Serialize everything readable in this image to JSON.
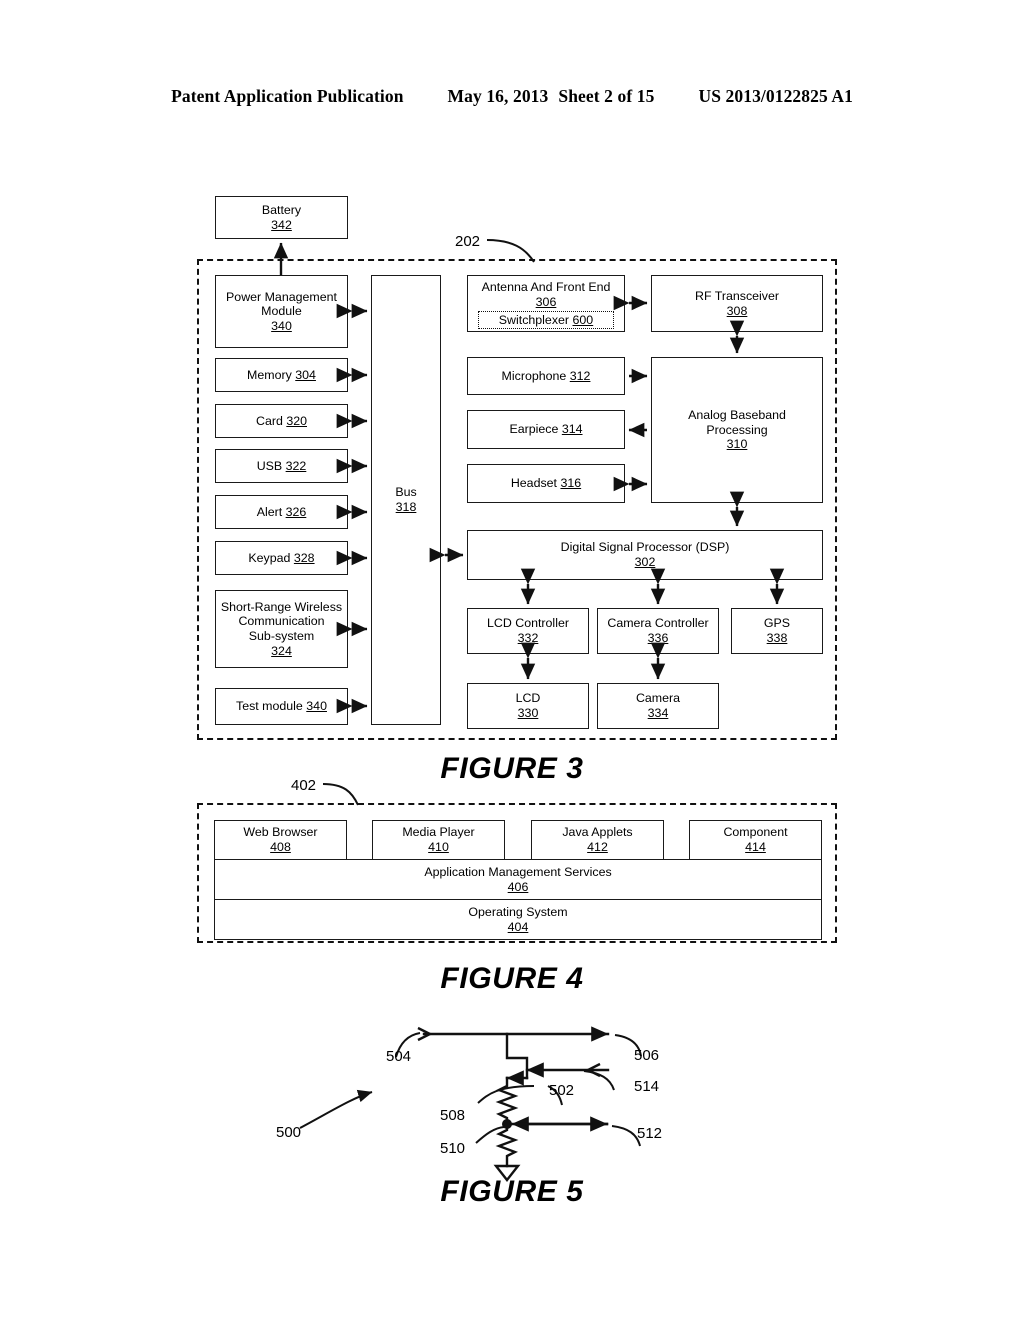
{
  "header": {
    "publication": "Patent Application Publication",
    "date": "May 16, 2013",
    "sheet": "Sheet 2 of 15",
    "docnum": "US 2013/0122825 A1"
  },
  "figure3": {
    "caption": "FIGURE 3",
    "container_ref": "202",
    "blocks": {
      "battery": {
        "title": "Battery",
        "ref": "342"
      },
      "power_mgmt": {
        "title": "Power Management",
        "title2": "Module",
        "ref": "340"
      },
      "memory": {
        "title": "Memory",
        "ref": "304"
      },
      "card": {
        "title": "Card",
        "ref": "320"
      },
      "usb": {
        "title": "USB",
        "ref": "322"
      },
      "alert": {
        "title": "Alert",
        "ref": "326"
      },
      "keypad": {
        "title": "Keypad",
        "ref": "328"
      },
      "srw": {
        "title": "Short-Range Wireless",
        "title2": "Communication",
        "title3": "Sub-system",
        "ref": "324"
      },
      "test": {
        "title": "Test module",
        "ref": "340"
      },
      "bus": {
        "title": "Bus",
        "ref": "318"
      },
      "antenna": {
        "title": "Antenna And Front End",
        "ref": "306"
      },
      "switchplexer": {
        "title": "Switchplexer",
        "ref": "600"
      },
      "rf": {
        "title": "RF Transceiver",
        "ref": "308"
      },
      "microphone": {
        "title": "Microphone",
        "ref": "312"
      },
      "earpiece": {
        "title": "Earpiece",
        "ref": "314"
      },
      "headset": {
        "title": "Headset",
        "ref": "316"
      },
      "abp": {
        "title": "Analog Baseband",
        "title2": "Processing",
        "ref": "310"
      },
      "dsp": {
        "title": "Digital Signal Processor (DSP)",
        "ref": "302"
      },
      "lcd_ctrl": {
        "title": "LCD Controller",
        "ref": "332"
      },
      "cam_ctrl": {
        "title": "Camera Controller",
        "ref": "336"
      },
      "gps": {
        "title": "GPS",
        "ref": "338"
      },
      "lcd": {
        "title": "LCD",
        "ref": "330"
      },
      "camera": {
        "title": "Camera",
        "ref": "334"
      }
    }
  },
  "figure4": {
    "caption": "FIGURE 4",
    "container_ref": "402",
    "blocks": {
      "web_browser": {
        "title": "Web Browser",
        "ref": "408"
      },
      "media_player": {
        "title": "Media Player",
        "ref": "410"
      },
      "java_applets": {
        "title": "Java Applets",
        "ref": "412"
      },
      "component": {
        "title": "Component",
        "ref": "414"
      },
      "ams": {
        "title": "Application Management Services",
        "ref": "406"
      },
      "os": {
        "title": "Operating System",
        "ref": "404"
      }
    }
  },
  "figure5": {
    "caption": "FIGURE 5",
    "refs": {
      "circuit": "500",
      "node": "502",
      "input_line": "504",
      "top_right": "506",
      "resistor_upper": "508",
      "resistor_lower": "510",
      "mid_right": "512",
      "second_right": "514"
    }
  }
}
